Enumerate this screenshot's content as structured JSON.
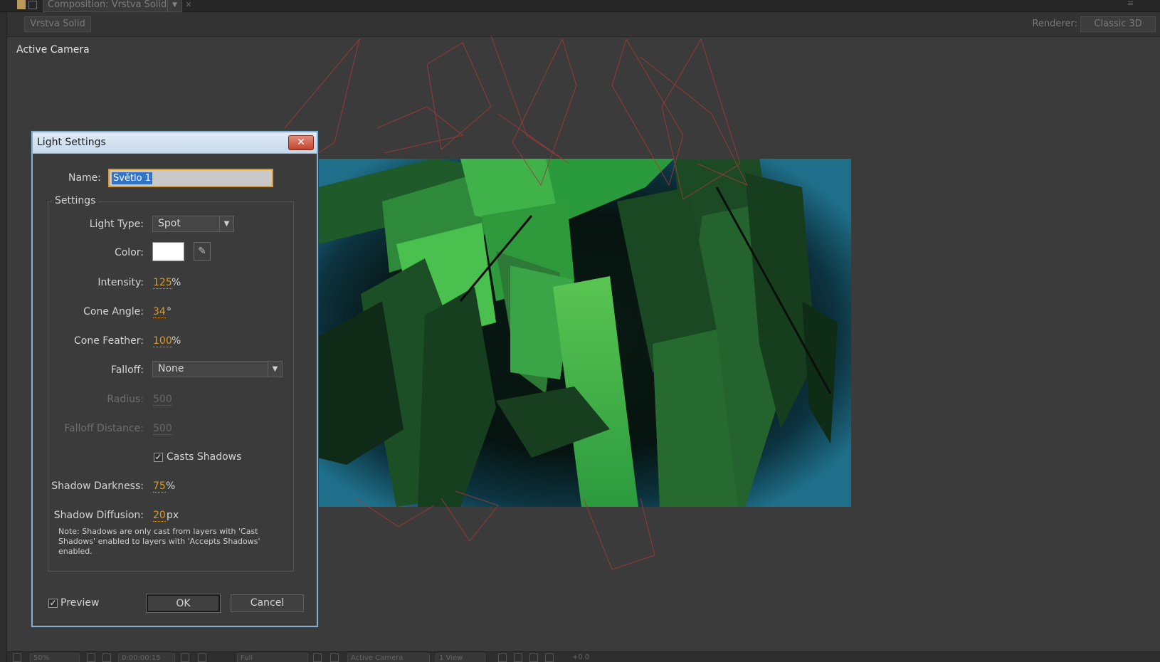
{
  "tabbar": {
    "tab_label": "Composition: Vrstva Solid"
  },
  "compbar": {
    "comp_name": "Vrstva Solid",
    "renderer_label": "Renderer:",
    "renderer_value": "Classic 3D"
  },
  "viewer": {
    "camera_label": "Active Camera"
  },
  "dialog": {
    "title": "Light Settings",
    "close_glyph": "✕",
    "name_label": "Name:",
    "name_value": "Světlo 1",
    "group_title": "Settings",
    "light_type_label": "Light Type:",
    "light_type_value": "Spot",
    "color_label": "Color:",
    "color_value": "#ffffff",
    "intensity_label": "Intensity:",
    "intensity_value": "125",
    "intensity_unit": "%",
    "cone_angle_label": "Cone Angle:",
    "cone_angle_value": "34",
    "cone_angle_unit": "°",
    "cone_feather_label": "Cone Feather:",
    "cone_feather_value": "100",
    "cone_feather_unit": "%",
    "falloff_label": "Falloff:",
    "falloff_value": "None",
    "radius_label": "Radius:",
    "radius_value": "500",
    "falloff_distance_label": "Falloff Distance:",
    "falloff_distance_value": "500",
    "casts_shadows_label": "Casts Shadows",
    "casts_shadows_checked": true,
    "shadow_darkness_label": "Shadow Darkness:",
    "shadow_darkness_value": "75",
    "shadow_darkness_unit": "%",
    "shadow_diffusion_label": "Shadow Diffusion:",
    "shadow_diffusion_value": "20",
    "shadow_diffusion_unit": "px",
    "note": "Note: Shadows are only cast from layers with 'Cast Shadows' enabled to layers with 'Accepts Shadows' enabled.",
    "preview_label": "Preview",
    "preview_checked": true,
    "ok_label": "OK",
    "cancel_label": "Cancel"
  },
  "bottombar": {
    "zoom": "50%",
    "timecode": "0:00:00:15",
    "resolution": "Full",
    "view": "Active Camera",
    "views": "1 View",
    "exposure": "+0.0"
  },
  "colors": {
    "accent_value": "#d99a2a",
    "dialog_border": "#7fb1d8",
    "scene_green": "#3fb24a",
    "scene_teal": "#1f6f8a",
    "wireframe": "#b23a3a"
  }
}
